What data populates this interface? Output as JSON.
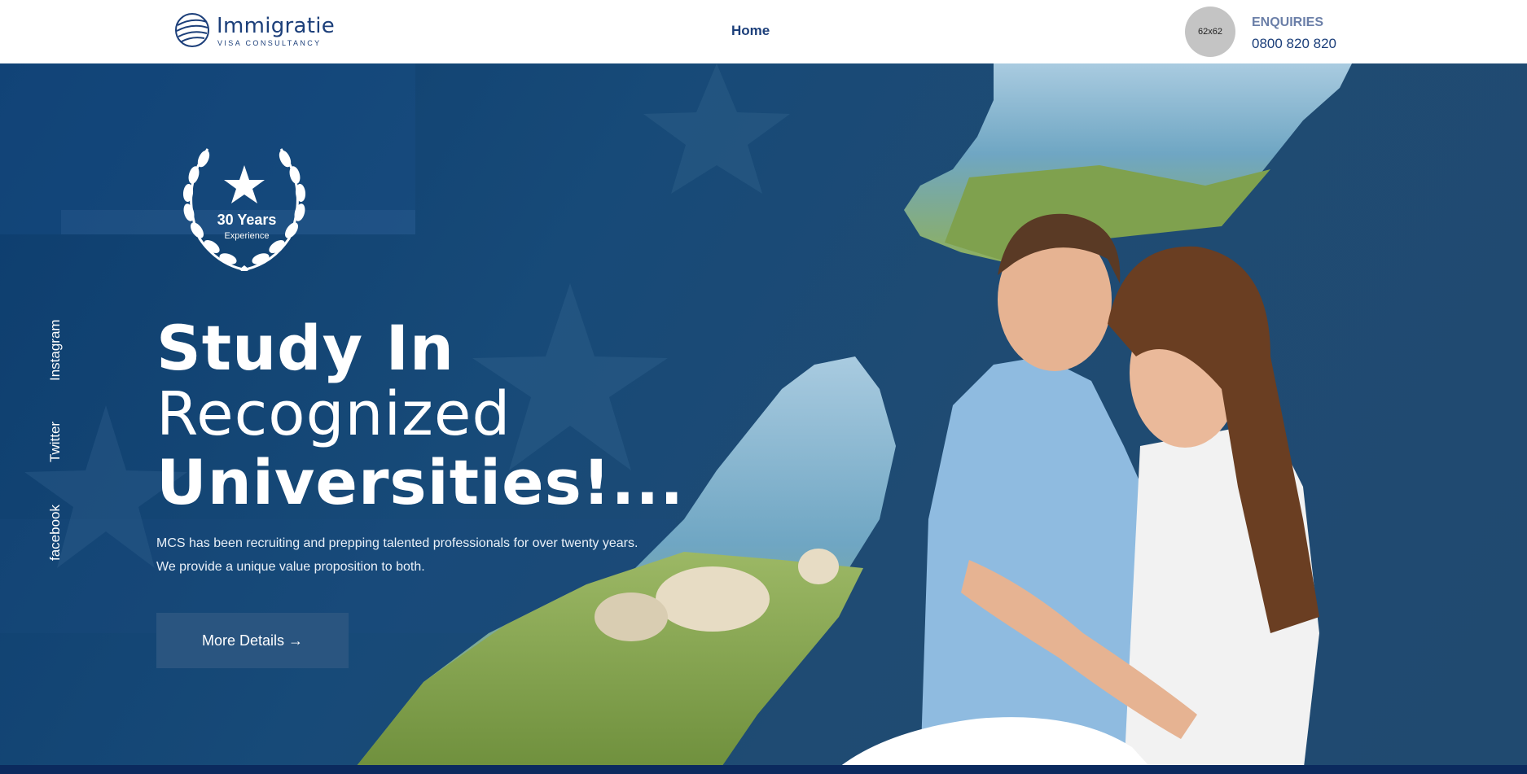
{
  "header": {
    "logo_name": "Immigratie",
    "logo_tagline": "VISA CONSULTANCY",
    "nav": {
      "home_label": "Home"
    },
    "avatar_placeholder": "62x62",
    "enquiries_label": "ENQUIRIES",
    "phone": "0800 820 820"
  },
  "hero": {
    "badge": {
      "years": "30 Years",
      "subtitle": "Experience"
    },
    "title_line1": "Study In",
    "title_line2": "Recognized",
    "title_line3": "Universities!...",
    "description": "MCS has been recruiting and prepping talented professionals for over twenty years. We provide a unique value proposition to both.",
    "button_label": "More Details →",
    "social": [
      "Instagram",
      "Twitter",
      "facebook"
    ]
  },
  "colors": {
    "brand": "#1c3f7a",
    "hero_bg": "#174a78",
    "button_bg": "#2a5580"
  }
}
